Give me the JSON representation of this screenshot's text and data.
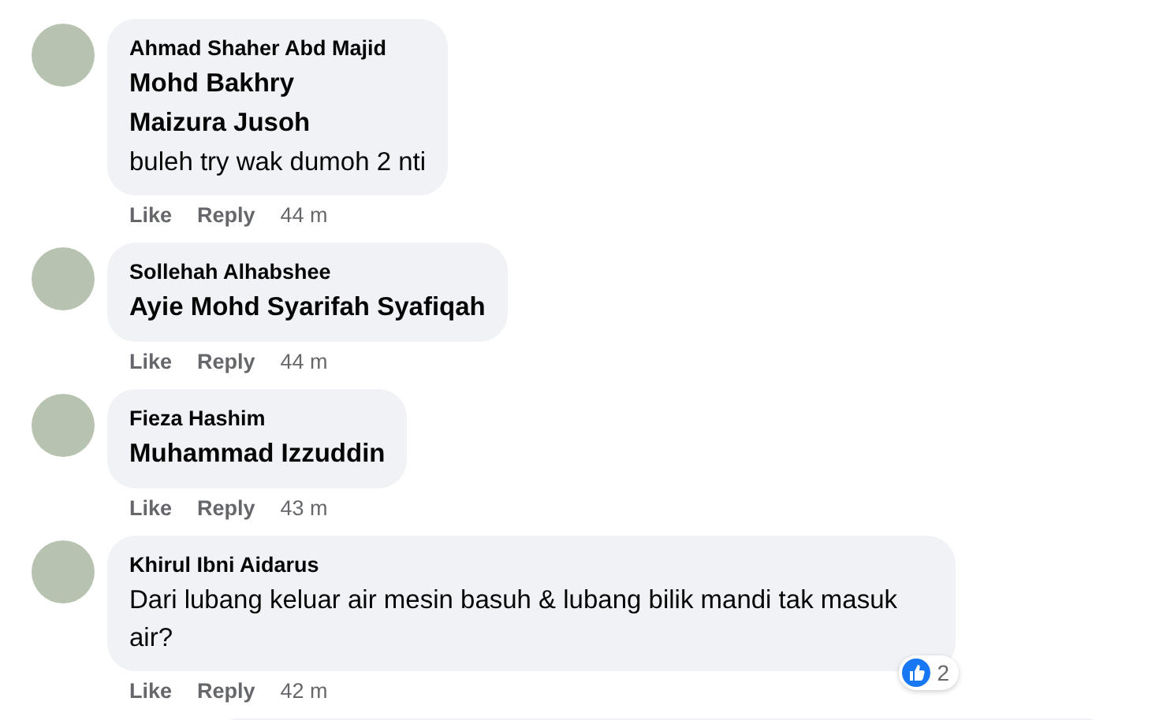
{
  "comments": [
    {
      "author": "Ahmad Shaher Abd Majid",
      "lines": [
        {
          "kind": "mention",
          "text": "Mohd Bakhry"
        },
        {
          "kind": "mention",
          "text": "Maizura Jusoh"
        },
        {
          "kind": "text",
          "text": "buleh try wak dumoh 2 nti"
        }
      ],
      "like": "Like",
      "reply": "Reply",
      "time": "44 m"
    },
    {
      "author": "Sollehah Alhabshee",
      "lines": [
        {
          "kind": "mention",
          "text": "Ayie Mohd Syarifah Syafiqah"
        }
      ],
      "like": "Like",
      "reply": "Reply",
      "time": "44 m"
    },
    {
      "author": "Fieza Hashim",
      "lines": [
        {
          "kind": "mention",
          "text": "Muhammad Izzuddin"
        }
      ],
      "like": "Like",
      "reply": "Reply",
      "time": "43 m"
    },
    {
      "author": "Khirul Ibni Aidarus",
      "lines": [
        {
          "kind": "text",
          "text": "Dari lubang keluar air mesin basuh & lubang bilik mandi tak masuk air?"
        }
      ],
      "like": "Like",
      "reply": "Reply",
      "time": "42 m",
      "reactions": "2"
    }
  ]
}
